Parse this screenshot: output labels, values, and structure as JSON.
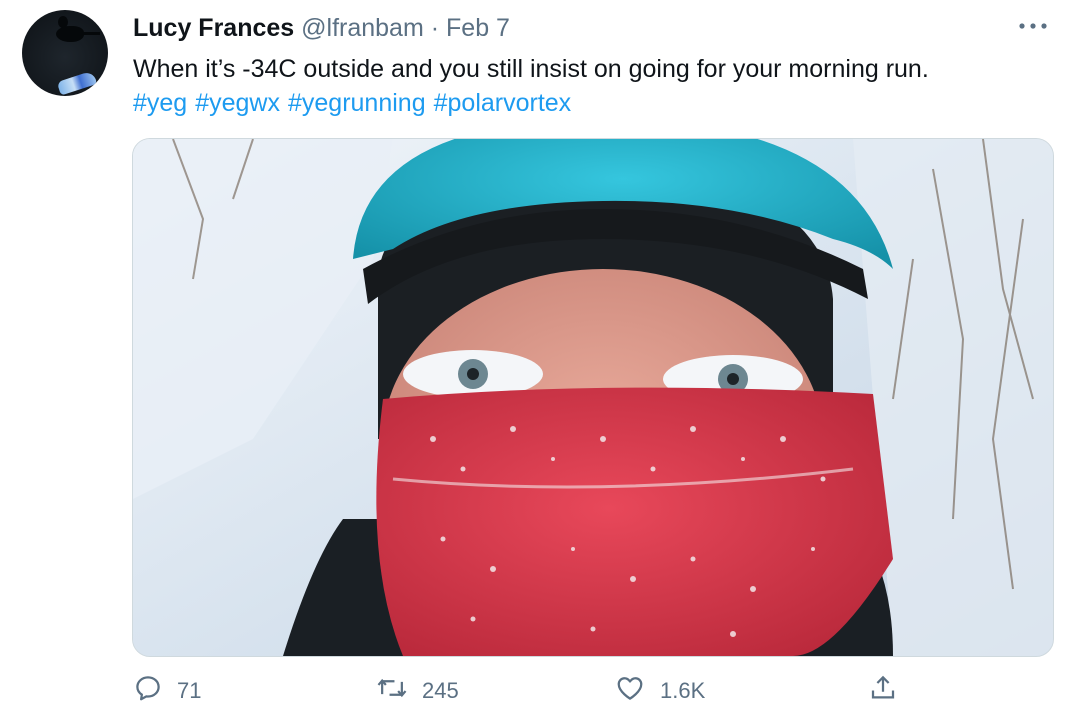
{
  "tweet": {
    "author_name": "Lucy Frances",
    "handle": "@lfranbam",
    "separator": "·",
    "date": "Feb 7",
    "text": "When it’s -34C outside and you still insist on going for your morning run.",
    "hashtags": [
      "#yeg",
      "#yegwx",
      "#yegrunning",
      "#polarvortex"
    ],
    "media_icon": "photo-selfie",
    "more_icon": "more-horizontal-icon"
  },
  "actions": {
    "reply": {
      "icon": "reply-icon",
      "count": "71"
    },
    "retweet": {
      "icon": "retweet-icon",
      "count": "245"
    },
    "like": {
      "icon": "heart-icon",
      "count": "1.6K"
    },
    "share": {
      "icon": "share-icon"
    }
  },
  "colors": {
    "text": "#0f1419",
    "secondary": "#5b7083",
    "link": "#1d9bf0"
  }
}
